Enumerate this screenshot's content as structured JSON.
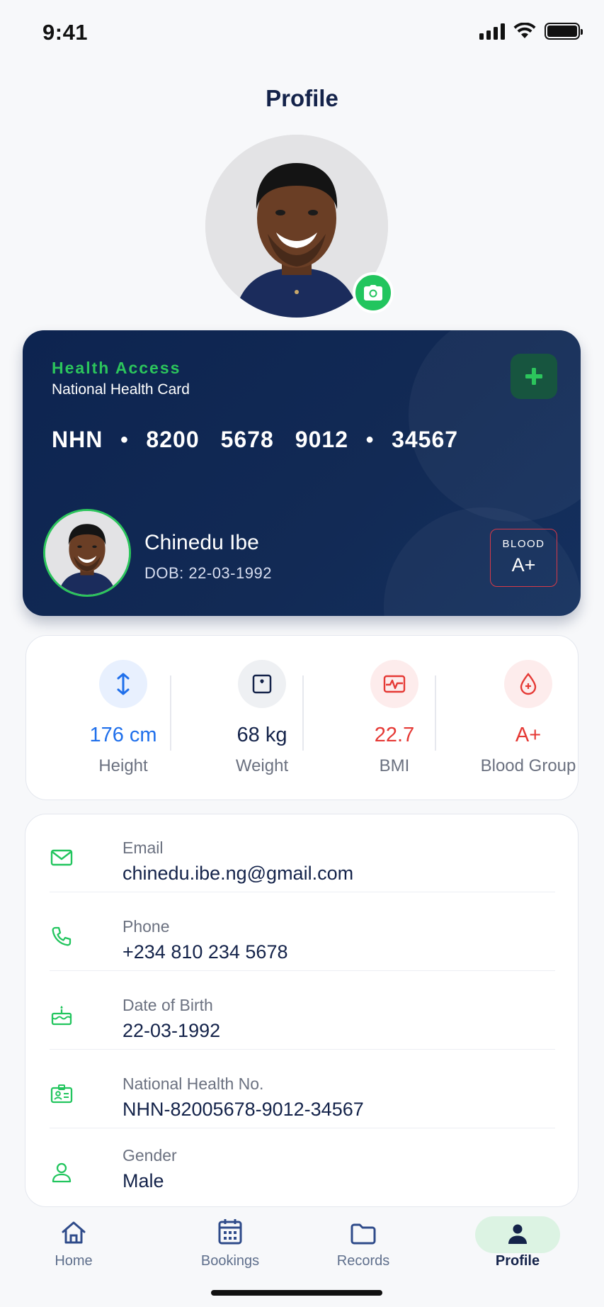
{
  "status_bar": {
    "time": "9:41"
  },
  "header": {
    "title": "Profile"
  },
  "profile": {
    "camera_icon": "camera-icon"
  },
  "health_card": {
    "brand": "Health Access",
    "subtitle": "National Health Card",
    "number_prefix": "NHN",
    "number_groups": [
      "8200",
      "5678",
      "9012"
    ],
    "number_suffix": "34567",
    "name": "Chinedu Ibe",
    "dob": "DOB: 22-03-1992",
    "blood_label": "BLOOD",
    "blood_value": "A+",
    "colors": {
      "background": "#0d2450",
      "accent": "#2cc55c",
      "blood_border": "#d63a48"
    }
  },
  "stats": [
    {
      "value": "176 cm",
      "label": "Height",
      "icon": "height-arrows-icon",
      "color": "#1f6feb",
      "bg": "#e8f0fe"
    },
    {
      "value": "68 kg",
      "label": "Weight",
      "icon": "scale-icon",
      "color": "#14234a",
      "bg": "#eef0f3"
    },
    {
      "value": "22.7",
      "label": "BMI",
      "icon": "heart-monitor-icon",
      "color": "#e53935",
      "bg": "#fdecec"
    },
    {
      "value": "A+",
      "label": "Blood Group",
      "icon": "blood-drop-icon",
      "color": "#e53935",
      "bg": "#fdecec"
    }
  ],
  "info": [
    {
      "label": "Email",
      "value": "chinedu.ibe.ng@gmail.com",
      "icon": "mail-icon"
    },
    {
      "label": "Phone",
      "value": "+234 810 234 5678",
      "icon": "phone-icon"
    },
    {
      "label": "Date of Birth",
      "value": "22-03-1992",
      "icon": "cake-icon"
    },
    {
      "label": "National Health No.",
      "value": "NHN-82005678-9012-34567",
      "icon": "id-card-icon"
    },
    {
      "label": "Gender",
      "value": "Male",
      "icon": "user-icon"
    }
  ],
  "tabs": [
    {
      "label": "Home",
      "icon": "home-icon"
    },
    {
      "label": "Bookings",
      "icon": "calendar-icon"
    },
    {
      "label": "Records",
      "icon": "folder-icon"
    },
    {
      "label": "Profile",
      "icon": "profile-icon",
      "active": true
    }
  ]
}
